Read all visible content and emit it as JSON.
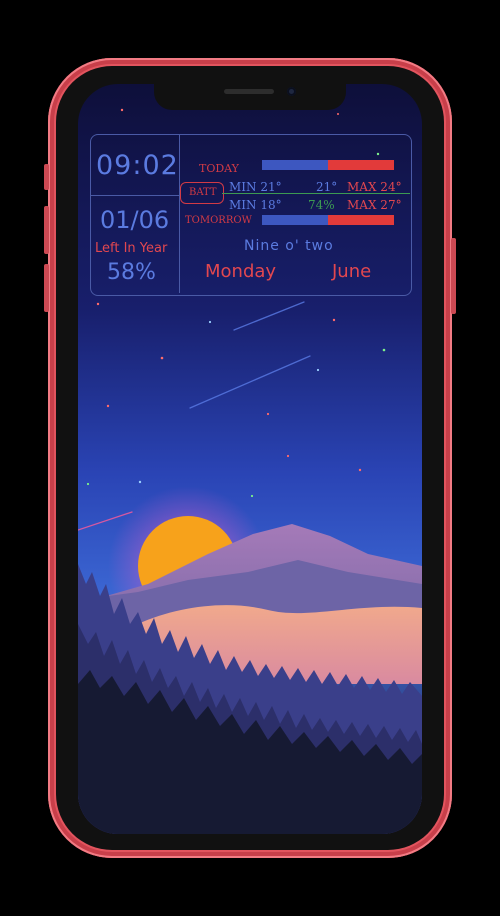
{
  "widget": {
    "time": "09:02",
    "date": "01/06",
    "left_in_year_label": "Left In Year",
    "left_in_year_percent": "58%",
    "today_label": "TODAY",
    "batt_label": "BATT",
    "today_min_label": "MIN 21°",
    "current_temp": "21°",
    "today_max_label": "MAX 24°",
    "tomorrow_min_label": "MIN 18°",
    "battery_percent": "74%",
    "tomorrow_max_label": "MAX 27°",
    "tomorrow_label": "TOMORROW",
    "time_in_words": "Nine o' two",
    "day_name": "Monday",
    "month_name": "June"
  },
  "colors": {
    "frame": "#e2545e",
    "accent_blue": "#5b7be0",
    "accent_red": "#e2474f",
    "accent_green": "#3c9a52",
    "sun": "#f7a21b"
  },
  "wallpaper": {
    "description_icon": "mountain-sunset-forest-wallpaper"
  }
}
